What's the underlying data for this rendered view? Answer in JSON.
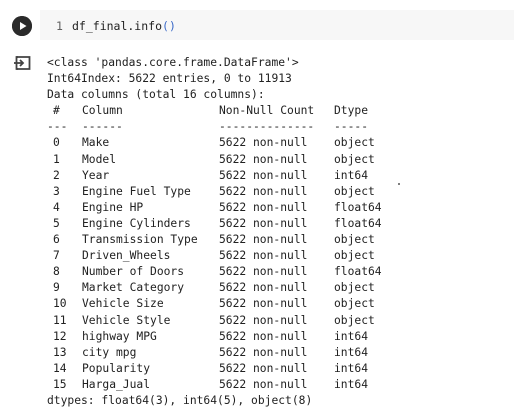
{
  "cell": {
    "line_number": "1",
    "code_prefix": "df_final.info",
    "code_parens": "()"
  },
  "output": {
    "header_lines": [
      "<class 'pandas.core.frame.DataFrame'>",
      "Int64Index: 5622 entries, 0 to 11913",
      "Data columns (total 16 columns):"
    ],
    "table_header": {
      "idx": "#",
      "column": "Column",
      "count": "Non-Null Count",
      "dtype": "Dtype"
    },
    "table_separator": {
      "idx": "---",
      "column": "------",
      "count": "--------------",
      "dtype": "-----"
    },
    "rows": [
      {
        "idx": "0",
        "column": "Make",
        "count": "5622 non-null",
        "dtype": "object"
      },
      {
        "idx": "1",
        "column": "Model",
        "count": "5622 non-null",
        "dtype": "object"
      },
      {
        "idx": "2",
        "column": "Year",
        "count": "5622 non-null",
        "dtype": "int64"
      },
      {
        "idx": "3",
        "column": "Engine Fuel Type",
        "count": "5622 non-null",
        "dtype": "object"
      },
      {
        "idx": "4",
        "column": "Engine HP",
        "count": "5622 non-null",
        "dtype": "float64"
      },
      {
        "idx": "5",
        "column": "Engine Cylinders",
        "count": "5622 non-null",
        "dtype": "float64"
      },
      {
        "idx": "6",
        "column": "Transmission Type",
        "count": "5622 non-null",
        "dtype": "object"
      },
      {
        "idx": "7",
        "column": "Driven_Wheels",
        "count": "5622 non-null",
        "dtype": "object"
      },
      {
        "idx": "8",
        "column": "Number of Doors",
        "count": "5622 non-null",
        "dtype": "float64"
      },
      {
        "idx": "9",
        "column": "Market Category",
        "count": "5622 non-null",
        "dtype": "object"
      },
      {
        "idx": "10",
        "column": "Vehicle Size",
        "count": "5622 non-null",
        "dtype": "object"
      },
      {
        "idx": "11",
        "column": "Vehicle Style",
        "count": "5622 non-null",
        "dtype": "object"
      },
      {
        "idx": "12",
        "column": "highway MPG",
        "count": "5622 non-null",
        "dtype": "int64"
      },
      {
        "idx": "13",
        "column": "city mpg",
        "count": "5622 non-null",
        "dtype": "int64"
      },
      {
        "idx": "14",
        "column": "Popularity",
        "count": "5622 non-null",
        "dtype": "int64"
      },
      {
        "idx": "15",
        "column": "Harga_Jual",
        "count": "5622 non-null",
        "dtype": "int64"
      }
    ],
    "footer": "dtypes: float64(3), int64(5), object(8)"
  },
  "icons": {
    "run": "play-icon",
    "output": "output-redirect-icon"
  }
}
